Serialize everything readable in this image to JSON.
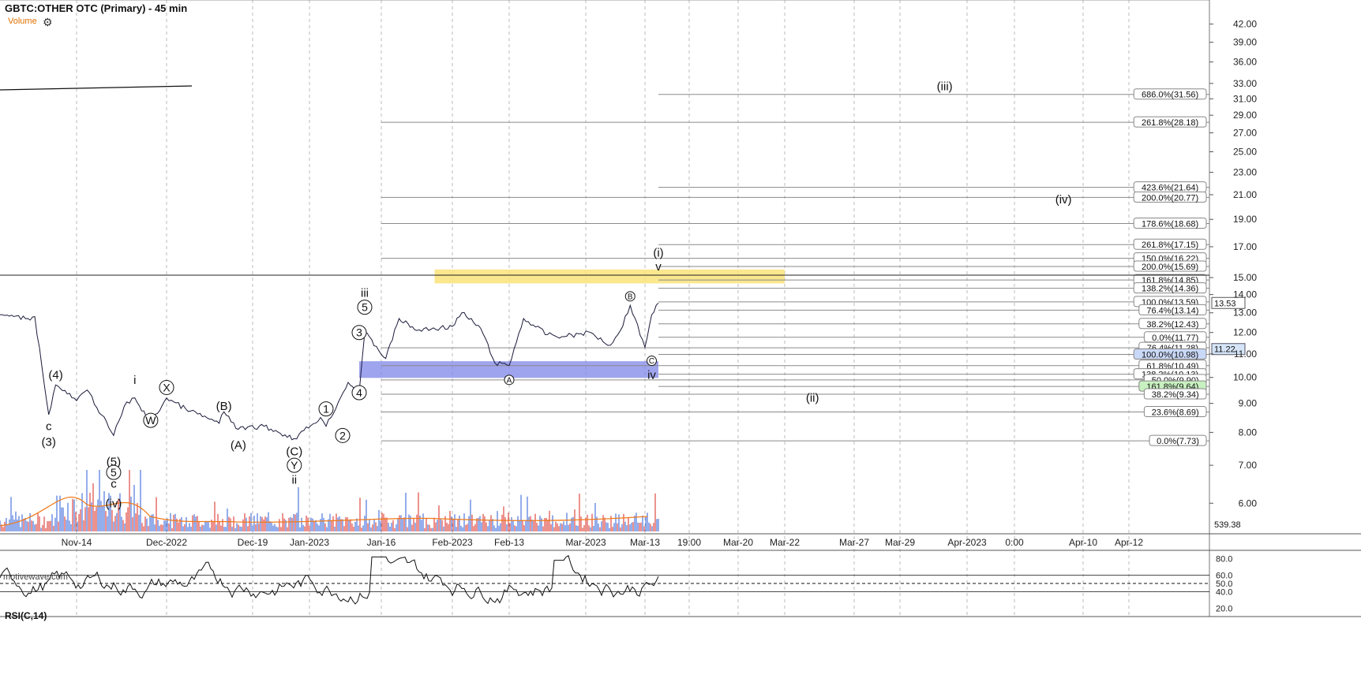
{
  "header": {
    "title": "GBTC:OTHER OTC (Primary) - 45 min",
    "volume_label": "Volume",
    "watermark": "motivewave.com"
  },
  "rsi": {
    "label": "RSI(C,14)",
    "axis_labels": [
      "80.0",
      "60.0",
      "50.0",
      "40.0",
      "20.0"
    ]
  },
  "colors": {
    "price": "#1a1a3a",
    "volume_up": "#2a5bd7",
    "volume_down": "#d8261c",
    "volume_ma": "#f07a1a",
    "target_box": "#f9e37a",
    "support_box": "#7f86e8",
    "fib_line": "#8a8a8a",
    "rsi_line": "#111111",
    "rsi_over": "#bcd5f2",
    "rsi_under": "#f4c6c6"
  },
  "chart_data": {
    "type": "line",
    "title": "GBTC:OTHER OTC (Primary) - 45 min",
    "ylim": [
      5.3,
      46.3
    ],
    "log_scale": true,
    "grid": "vertical dashed",
    "y_tick_labels": [
      "42.00",
      "39.00",
      "36.00",
      "33.00",
      "31.00",
      "29.00",
      "27.00",
      "25.00",
      "23.00",
      "21.00",
      "19.00",
      "17.00",
      "15.00",
      "14.00",
      "13.00",
      "12.00",
      "11.00",
      "10.00",
      "9.00",
      "8.00",
      "7.00",
      "6.00"
    ],
    "x_tick_labels": [
      "Nov-14",
      "Dec-2022",
      "Dec-19",
      "Jan-2023",
      "Jan-16",
      "Feb-2023",
      "Feb-13",
      "Mar-2023",
      "Mar-13",
      "19:00",
      "Mar-20",
      "Mar-22",
      "Mar-27",
      "Mar-29",
      "Apr-2023",
      "0:00",
      "Apr-10",
      "Apr-12"
    ],
    "price_waypoints": [
      {
        "date": "Nov-03",
        "close": 12.9
      },
      {
        "date": "Nov-07",
        "close": 12.7
      },
      {
        "date": "Nov-08",
        "close": 12.8
      },
      {
        "date": "Nov-09",
        "close": 10.5
      },
      {
        "date": "Nov-10",
        "close": 8.6
      },
      {
        "date": "Nov-11",
        "close": 9.7
      },
      {
        "date": "Nov-14",
        "close": 9.1
      },
      {
        "date": "Nov-16",
        "close": 9.5
      },
      {
        "date": "Nov-21",
        "close": 7.9
      },
      {
        "date": "Nov-23",
        "close": 8.9
      },
      {
        "date": "Nov-25",
        "close": 9.2
      },
      {
        "date": "Nov-28",
        "close": 8.3
      },
      {
        "date": "Dec-01",
        "close": 9.2
      },
      {
        "date": "Dec-05",
        "close": 8.8
      },
      {
        "date": "Dec-12",
        "close": 8.3
      },
      {
        "date": "Dec-13",
        "close": 8.7
      },
      {
        "date": "Dec-16",
        "close": 8.1
      },
      {
        "date": "Dec-22",
        "close": 8.2
      },
      {
        "date": "Dec-30",
        "close": 7.8
      },
      {
        "date": "Jan-05",
        "close": 8.5
      },
      {
        "date": "Jan-06",
        "close": 8.2
      },
      {
        "date": "Jan-10",
        "close": 9.8
      },
      {
        "date": "Jan-12",
        "close": 9.4
      },
      {
        "date": "Jan-13",
        "close": 12.0
      },
      {
        "date": "Jan-17",
        "close": 10.8
      },
      {
        "date": "Jan-20",
        "close": 12.7
      },
      {
        "date": "Jan-24",
        "close": 12.1
      },
      {
        "date": "Feb-01",
        "close": 12.3
      },
      {
        "date": "Feb-03",
        "close": 13.0
      },
      {
        "date": "Feb-07",
        "close": 12.2
      },
      {
        "date": "Feb-10",
        "close": 10.6
      },
      {
        "date": "Feb-13",
        "close": 10.5
      },
      {
        "date": "Feb-16",
        "close": 12.7
      },
      {
        "date": "Feb-21",
        "close": 11.9
      },
      {
        "date": "Feb-24",
        "close": 11.8
      },
      {
        "date": "Mar-02",
        "close": 12.0
      },
      {
        "date": "Mar-06",
        "close": 11.4
      },
      {
        "date": "Mar-08",
        "close": 12.1
      },
      {
        "date": "Mar-10",
        "close": 13.4
      },
      {
        "date": "Mar-13",
        "close": 11.3
      },
      {
        "date": "Mar-14",
        "close": 12.9
      },
      {
        "date": "Mar-15",
        "close": 13.53
      }
    ],
    "last_price": "13.53",
    "price_tags": [
      "11.22"
    ],
    "volume_tag": "539.38",
    "zones": [
      {
        "name": "target",
        "from": "Jan-28",
        "to": "Mar-22",
        "low": 14.65,
        "high": 15.5
      },
      {
        "name": "support",
        "from": "Jan-12",
        "to": "Mar-15",
        "low": 9.98,
        "high": 10.68
      }
    ],
    "levels": [
      {
        "label": "686.0%(31.56)",
        "value": 31.56,
        "from": "Mar-15"
      },
      {
        "label": "261.8%(28.18)",
        "value": 28.18,
        "from": "Jan-16"
      },
      {
        "label": "423.6%(21.64)",
        "value": 21.64,
        "from": "Mar-15"
      },
      {
        "label": "200.0%(20.77)",
        "value": 20.77,
        "from": "Jan-16"
      },
      {
        "label": "178.6%(18.68)",
        "value": 18.68,
        "from": "Jan-16"
      },
      {
        "label": "261.8%(17.15)",
        "value": 17.15,
        "from": "Mar-15"
      },
      {
        "label": "150.0%(16.22)",
        "value": 16.22,
        "from": "Jan-16"
      },
      {
        "label": "200.0%(15.69)",
        "value": 15.69,
        "from": "Mar-15"
      },
      {
        "label": "161.8%(14.85)",
        "value": 14.85,
        "from": "Mar-15"
      },
      {
        "label": "138.2%(14.36)",
        "value": 14.36,
        "from": "Mar-15"
      },
      {
        "label": "100.0%(13.59)",
        "value": 13.59,
        "from": "Mar-15"
      },
      {
        "label": "76.4%(13.14)",
        "value": 13.14,
        "from": "Mar-15"
      },
      {
        "label": "38.2%(12.43)",
        "value": 12.43,
        "from": "Mar-15"
      },
      {
        "label": "0.0%(11.77)",
        "value": 11.77,
        "from": "Mar-15"
      },
      {
        "label": "76.4%(11.28)",
        "value": 11.28,
        "from": "Jan-16"
      },
      {
        "label": "100.0%(10.98)",
        "value": 10.98,
        "from": "Mar-15"
      },
      {
        "label": "61.8%(10.49)",
        "value": 10.49,
        "from": "Jan-16"
      },
      {
        "label": "138.2%(10.13)",
        "value": 10.13,
        "from": "Mar-15"
      },
      {
        "label": "50.0%(9.90)",
        "value": 9.9,
        "from": "Jan-16"
      },
      {
        "label": "161.8%(9.64)",
        "value": 9.64,
        "from": "Mar-15"
      },
      {
        "label": "38.2%(9.34)",
        "value": 9.34,
        "from": "Jan-16"
      },
      {
        "label": "23.6%(8.69)",
        "value": 8.69,
        "from": "Jan-16"
      },
      {
        "label": "0.0%(7.73)",
        "value": 7.73,
        "from": "Jan-16"
      }
    ],
    "wave_labels": [
      {
        "text": "(iii)",
        "date": "Mar-31",
        "value": 32.6
      },
      {
        "text": "(iv)",
        "date": "Apr-08",
        "value": 20.6
      },
      {
        "text": "(i)",
        "date": "Mar-15",
        "value": 16.6
      },
      {
        "text": "v",
        "date": "Mar-15",
        "value": 15.7
      },
      {
        "text": "(ii)",
        "date": "Mar-24",
        "value": 9.2
      },
      {
        "text": "iii",
        "date": "Jan-13",
        "value": 14.1
      },
      {
        "text": "5",
        "date": "Jan-13",
        "value": 13.3,
        "circle": true
      },
      {
        "text": "3",
        "date": "Jan-12",
        "value": 12.0,
        "circle": true
      },
      {
        "text": "4",
        "date": "Jan-12",
        "value": 9.4,
        "circle": true
      },
      {
        "text": "1",
        "date": "Jan-06",
        "value": 8.8,
        "circle": true
      },
      {
        "text": "2",
        "date": "Jan-09",
        "value": 7.9,
        "circle": true
      },
      {
        "text": "(C)",
        "date": "Dec-30",
        "value": 7.4
      },
      {
        "text": "Y",
        "date": "Dec-30",
        "value": 7.0,
        "circle": true
      },
      {
        "text": "ii",
        "date": "Dec-30",
        "value": 6.6
      },
      {
        "text": "(A)",
        "date": "Dec-16",
        "value": 7.6
      },
      {
        "text": "(B)",
        "date": "Dec-13",
        "value": 8.9
      },
      {
        "text": "X",
        "date": "Dec-01",
        "value": 9.6,
        "circle": true
      },
      {
        "text": "W",
        "date": "Nov-28",
        "value": 8.4,
        "circle": true
      },
      {
        "text": "i",
        "date": "Nov-25",
        "value": 9.9
      },
      {
        "text": "(4)",
        "date": "Nov-11",
        "value": 10.1
      },
      {
        "text": "c",
        "date": "Nov-10",
        "value": 8.2
      },
      {
        "text": "(3)",
        "date": "Nov-10",
        "value": 7.7
      },
      {
        "text": "(5)",
        "date": "Nov-21",
        "value": 7.1
      },
      {
        "text": "5",
        "date": "Nov-21",
        "value": 6.8,
        "circle": true
      },
      {
        "text": "c",
        "date": "Nov-21",
        "value": 6.5
      },
      {
        "text": "(iv)",
        "date": "Nov-21",
        "value": 6.0
      },
      {
        "text": "A",
        "date": "Feb-13",
        "value": 9.9,
        "circle": true,
        "small": true
      },
      {
        "text": "B",
        "date": "Mar-10",
        "value": 13.9,
        "circle": true,
        "small": true
      },
      {
        "text": "C",
        "date": "Mar-14",
        "value": 10.7,
        "circle": true,
        "small": true
      },
      {
        "text": "iv",
        "date": "Mar-14",
        "value": 10.1
      }
    ]
  }
}
